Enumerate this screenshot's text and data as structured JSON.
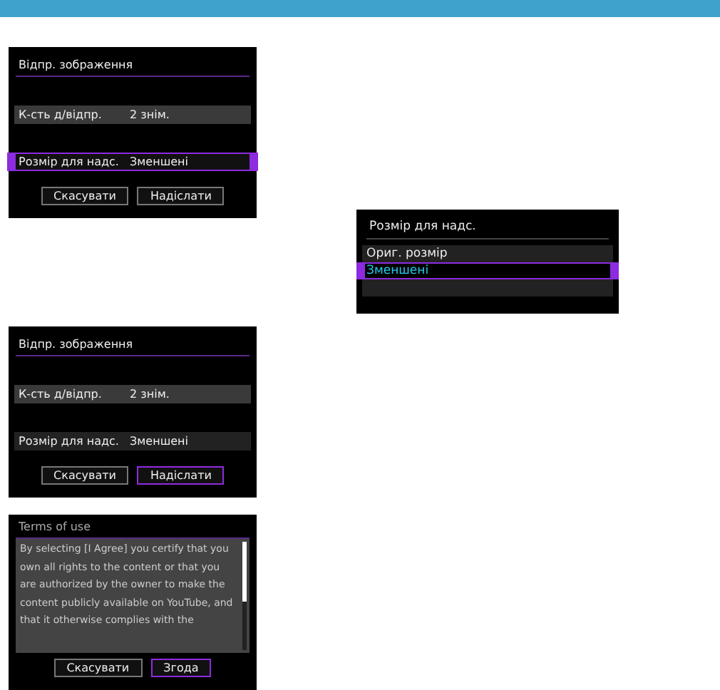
{
  "screens": [
    {
      "kind": "send",
      "title": "Відпр. зображення",
      "rows": [
        {
          "label": "К-сть д/відпр.",
          "value": "2 знім.",
          "selected": false
        },
        {
          "label": "Розмір для надс.",
          "value": "Зменшені",
          "selected": true
        }
      ],
      "buttons": [
        {
          "label": "Скасувати",
          "selected": false
        },
        {
          "label": "Надіслати",
          "selected": false
        }
      ]
    },
    {
      "kind": "send",
      "title": "Відпр. зображення",
      "rows": [
        {
          "label": "К-сть д/відпр.",
          "value": "2 знім.",
          "selected": false
        },
        {
          "label": "Розмір для надс.",
          "value": "Зменшені",
          "selected": false
        }
      ],
      "buttons": [
        {
          "label": "Скасувати",
          "selected": false
        },
        {
          "label": "Надіслати",
          "selected": true
        }
      ]
    },
    {
      "kind": "terms",
      "title": "Terms of use",
      "text": "By selecting [I Agree] you certify that you own all rights to the content or that you are authorized by the owner to make the content publicly available on YouTube, and that it otherwise complies with the",
      "buttons": [
        {
          "label": "Скасувати",
          "selected": false
        },
        {
          "label": "Згода",
          "selected": true
        }
      ]
    }
  ],
  "popup": {
    "title": "Розмір для надс.",
    "options": [
      {
        "label": "Ориг. розмір",
        "selected": false
      },
      {
        "label": "Зменшені",
        "selected": true
      }
    ]
  }
}
